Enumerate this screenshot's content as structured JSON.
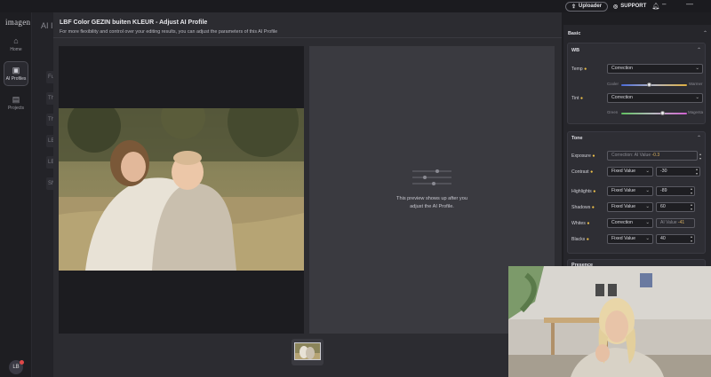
{
  "app": {
    "logo": "imagen"
  },
  "background": {
    "title": "AI I",
    "items": [
      "Fu",
      "Th",
      "Th",
      "LB",
      "LB",
      "SN"
    ]
  },
  "rail": {
    "items": [
      {
        "label": "Home",
        "icon": "home-icon"
      },
      {
        "label": "AI Profiles",
        "icon": "ai-profiles-icon"
      },
      {
        "label": "Projects",
        "icon": "projects-icon"
      }
    ],
    "avatar": "LB"
  },
  "topbar": {
    "uploader": "Uploader",
    "support": "SUPPORT"
  },
  "modal": {
    "title": "LBF Color GEZIN buiten KLEUR - Adjust AI Profile",
    "subtitle": "For more flexibility and control over your editing results, you can adjust the parameters of this AI Profile",
    "preview_line1": "This preview shows up after you",
    "preview_line2": "adjust the AI Profile."
  },
  "settings": {
    "basic_title": "Basic",
    "wb": {
      "title": "WB",
      "temp": {
        "label": "Temp",
        "mode": "Correction",
        "min_label": "Cooler",
        "max_label": "Warmer",
        "position": 0.42
      },
      "tint": {
        "label": "Tint",
        "mode": "Correction",
        "min_label": "Green",
        "max_label": "Magenta",
        "position": 0.6
      }
    },
    "tone": {
      "title": "Tone",
      "rows": [
        {
          "label": "Exposure",
          "mode": "Correction: AI Value",
          "value": "-0.3"
        },
        {
          "label": "Contrast",
          "mode": "Fixed Value",
          "value": "-30"
        },
        {
          "label": "Highlights",
          "mode": "Fixed Value",
          "value": "-89"
        },
        {
          "label": "Shadows",
          "mode": "Fixed Value",
          "value": "60"
        },
        {
          "label": "Whites",
          "mode": "Correction",
          "ai_label": "AI Value",
          "value": "-41"
        },
        {
          "label": "Blacks",
          "mode": "Fixed Value",
          "value": "40"
        }
      ]
    },
    "presence_title": "Presence"
  },
  "colors": {
    "accent_dot": "#f0c24a",
    "panel": "#2c2c31",
    "preview": "#3a3a40"
  }
}
